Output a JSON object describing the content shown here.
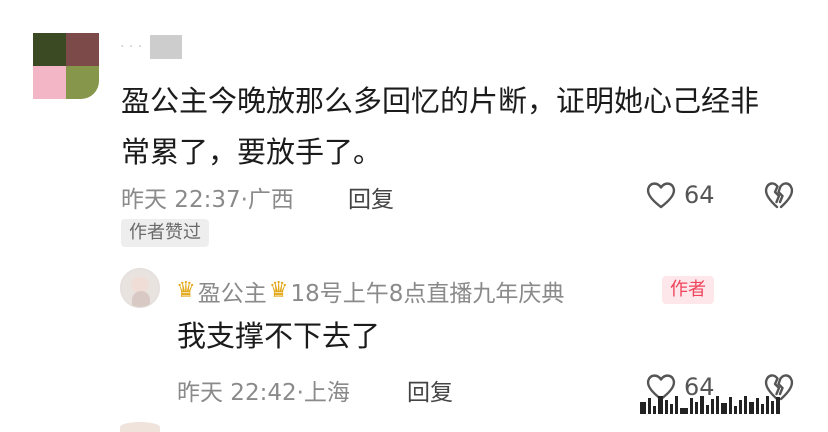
{
  "comment": {
    "text_line1": "盈公主今晚放那么多回忆的片断，证明她心己经非",
    "text_line2": "常累了，要放手了。",
    "time": "昨天 22:37",
    "separator": "·",
    "location": "广西",
    "reply_label": "回复",
    "like_count": "64",
    "author_liked_tag": "作者赞过",
    "avatar_colors": [
      "#3c4a23",
      "#7d4a4a",
      "#f2b6c6",
      "#86964a"
    ]
  },
  "reply": {
    "author_name": "盈公主",
    "name_suffix": "18号上午8点直播九年庆典",
    "badge": "作者",
    "text": "我支撑不下去了",
    "time": "昨天 22:42",
    "separator": "·",
    "location": "上海",
    "reply_label": "回复",
    "like_count": "64"
  },
  "colors": {
    "badge_text": "#f0445c",
    "badge_bg": "#fde7ea",
    "crown": "#e3a81a"
  }
}
